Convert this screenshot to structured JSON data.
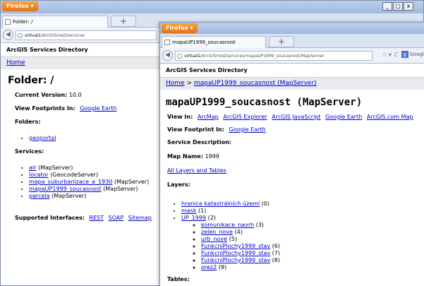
{
  "back_window": {
    "app_button": "Firefox",
    "window_controls": [
      "_",
      "□",
      "x"
    ],
    "tab_title": "Folder: /",
    "new_tab": "+",
    "url": "virtual1/ArcGIS/rest/services",
    "url_host": "virtual1",
    "url_path": "/ArcGIS/rest/services",
    "dir_title": "ArcGIS Services Directory",
    "home_link": "Home",
    "heading": "Folder: /",
    "current_version_label": "Current Version:",
    "current_version": "10.0",
    "view_footprints_label": "View Footprints In:",
    "view_footprints_link": "Google Earth",
    "folders_label": "Folders:",
    "folders": [
      "geoportal"
    ],
    "services_label": "Services:",
    "services": [
      {
        "name": "air",
        "type": "(MapServer)"
      },
      {
        "name": "locator",
        "type": "(GeocodeServer)"
      },
      {
        "name": "mapa_suburbanizace_a_1930",
        "type": "(MapServer)"
      },
      {
        "name": "mapaUP1999_soucasnost",
        "type": "(MapServer)"
      },
      {
        "name": "parcela",
        "type": "(MapServer)"
      }
    ],
    "supported_label": "Supported Interfaces:",
    "supported": [
      "REST",
      "SOAP",
      "Sitemap"
    ]
  },
  "front_window": {
    "app_button": "Firefox",
    "tab_title": "mapaUP1999_soucasnost (MapServer)",
    "new_tab": "+",
    "url_host": "virtual1",
    "url_path": "/ArcGIS/rest/services/mapaUP1999_soucasnost/MapServer",
    "search_engine": "Googl",
    "dir_title": "ArcGIS Services Directory",
    "breadcrumb_home": "Home",
    "breadcrumb_sep": ">",
    "breadcrumb_current": "mapaUP1999_soucasnost (MapServer)",
    "heading": "mapaUP1999_soucasnost (MapServer)",
    "view_in_label": "View In:",
    "view_in_links": [
      "ArcMap",
      "ArcGIS Explorer",
      "ArcGIS JavaScript",
      "Google Earth",
      "ArcGIS.com Map"
    ],
    "view_footprint_label": "View Footprint In:",
    "view_footprint_link": "Google Earth",
    "service_desc_label": "Service Description:",
    "map_name_label": "Map Name:",
    "map_name": "1999",
    "all_layers_link": "All Layers and Tables",
    "layers_label": "Layers:",
    "layers": [
      {
        "name": "hranice katastrálních území",
        "id": "(0)"
      },
      {
        "name": "mask",
        "id": "(1)"
      },
      {
        "name": "UP_1999",
        "id": "(2)"
      }
    ],
    "sublayers": [
      {
        "name": "komunikace_navrh",
        "id": "(3)"
      },
      {
        "name": "zelen_nove",
        "id": "(4)"
      },
      {
        "name": "urb_nove",
        "id": "(5)"
      },
      {
        "name": "FunkcniPlochy1999_stav",
        "id": "(6)"
      },
      {
        "name": "FunkcniPlochy1999_stav",
        "id": "(7)"
      },
      {
        "name": "FunkcniPlochy1999_stav",
        "id": "(8)"
      },
      {
        "name": "orez2",
        "id": "(9)"
      }
    ],
    "tables_label": "Tables:"
  }
}
